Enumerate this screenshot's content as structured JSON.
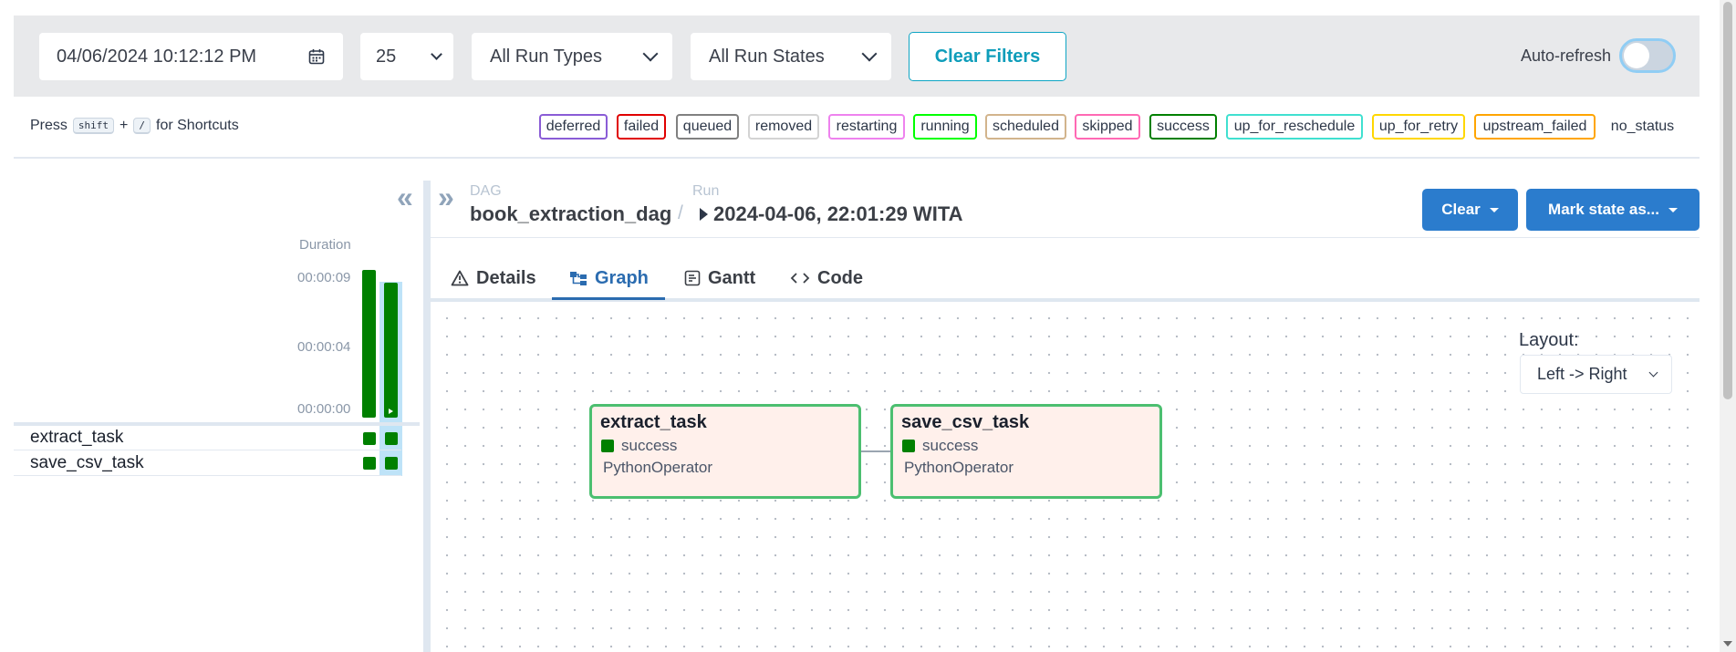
{
  "filters": {
    "date_value": "04/06/2024 10:12:12 PM",
    "num_runs": "25",
    "run_types": "All Run Types",
    "run_states": "All Run States",
    "clear_filters": "Clear Filters",
    "auto_refresh_label": "Auto-refresh",
    "auto_refresh_on": false
  },
  "shortcuts": {
    "press": "Press",
    "key1": "shift",
    "plus": "+",
    "key2": "/",
    "suffix": "for Shortcuts"
  },
  "legend": [
    {
      "label": "deferred",
      "color": "#8a5cd6"
    },
    {
      "label": "failed",
      "color": "#e00000"
    },
    {
      "label": "queued",
      "color": "#808080"
    },
    {
      "label": "removed",
      "color": "#d3d3d3"
    },
    {
      "label": "restarting",
      "color": "#ee82ee"
    },
    {
      "label": "running",
      "color": "#00ff00"
    },
    {
      "label": "scheduled",
      "color": "#d2b48c"
    },
    {
      "label": "skipped",
      "color": "#ff69b4"
    },
    {
      "label": "success",
      "color": "#008000"
    },
    {
      "label": "up_for_reschedule",
      "color": "#40e0d0"
    },
    {
      "label": "up_for_retry",
      "color": "#ffd700"
    },
    {
      "label": "upstream_failed",
      "color": "#ffa500"
    },
    {
      "label": "no_status",
      "color": "#ffffff"
    }
  ],
  "grid": {
    "duration_label": "Duration",
    "ticks": [
      "00:00:09",
      "00:00:04",
      "00:00:00"
    ],
    "run_durations_seconds": [
      9.5,
      8.7
    ],
    "tasks": [
      "extract_task",
      "save_csv_task"
    ]
  },
  "header": {
    "dag_label": "DAG",
    "dag_id": "book_extraction_dag",
    "separator": "/",
    "run_label": "Run",
    "run_id": "2024-04-06, 22:01:29 WITA",
    "clear_button": "Clear",
    "mark_state_button": "Mark state as..."
  },
  "tabs": [
    {
      "label": "Details",
      "icon": "warning-icon"
    },
    {
      "label": "Graph",
      "icon": "graph-icon",
      "active": true
    },
    {
      "label": "Gantt",
      "icon": "gantt-icon"
    },
    {
      "label": "Code",
      "icon": "code-icon"
    }
  ],
  "graph": {
    "layout_label": "Layout:",
    "layout_value": "Left -> Right",
    "nodes": [
      {
        "name": "extract_task",
        "state": "success",
        "operator": "PythonOperator"
      },
      {
        "name": "save_csv_task",
        "state": "success",
        "operator": "PythonOperator"
      }
    ]
  },
  "colors": {
    "success": "#008000",
    "primary": "#2b7ccd",
    "accent": "#0e9dba"
  }
}
